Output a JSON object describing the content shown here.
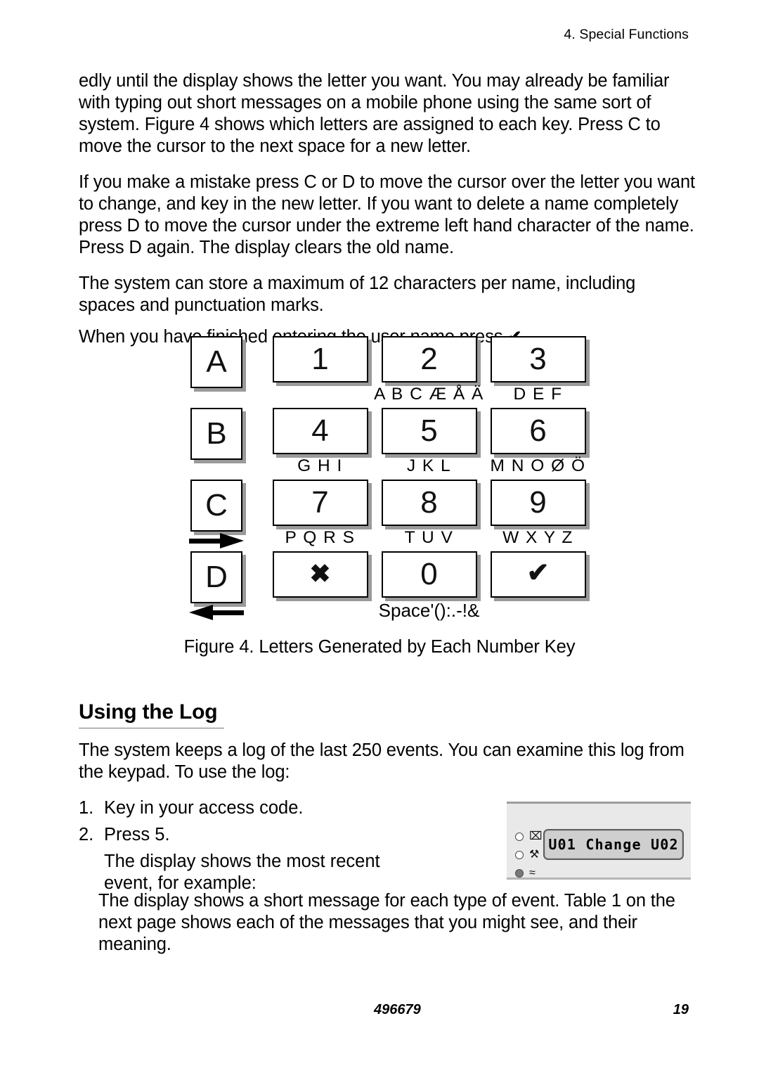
{
  "header": {
    "running_head": "4. Special Functions"
  },
  "paragraphs": {
    "p1": "edly until the display shows the letter you want. You may already be familiar with typing out short messages on a mobile phone using the same sort of system. Figure 4 shows which letters are assigned to each key. Press C to move the cursor to the next space for a new letter.",
    "p2": "If you make a mistake press C or D to move the cursor over the letter you want to change, and key in the new letter. If you want to delete a name completely press D to move the cursor under the extreme left hand character of the name. Press D again. The display clears the old name.",
    "p3": "The system can store a maximum of 12 characters per name, including spaces and punctuation marks.",
    "p4_before_tick": "When you have finished entering the user name press ",
    "p4_tick": "✔",
    "p4_after_tick": "."
  },
  "figure": {
    "caption": "Figure 4. Letters Generated by Each Number Key",
    "rows": [
      {
        "letter_key": "A",
        "letter_key_arrow": "",
        "keys": [
          {
            "face": "1",
            "sub": ""
          },
          {
            "face": "2",
            "sub": "A B C Æ Å Ä"
          },
          {
            "face": "3",
            "sub": "D E F"
          }
        ]
      },
      {
        "letter_key": "B",
        "letter_key_arrow": "",
        "keys": [
          {
            "face": "4",
            "sub": "G H I"
          },
          {
            "face": "5",
            "sub": "J K L"
          },
          {
            "face": "6",
            "sub": "M N O Ø Ö"
          }
        ]
      },
      {
        "letter_key": "C",
        "letter_key_arrow": "arrow-right-icon",
        "keys": [
          {
            "face": "7",
            "sub": "P Q R S"
          },
          {
            "face": "8",
            "sub": "T U V"
          },
          {
            "face": "9",
            "sub": "W X Y Z"
          }
        ]
      },
      {
        "letter_key": "D",
        "letter_key_arrow": "arrow-left-icon",
        "keys": [
          {
            "face": "✖",
            "sub": ""
          },
          {
            "face": "0",
            "sub": "Space'():.-!&"
          },
          {
            "face": "✔",
            "sub": ""
          }
        ]
      }
    ]
  },
  "section": {
    "heading": "Using the Log",
    "intro": "The system keeps a log of the last 250 events. You can examine this log from the keypad. To use the log:",
    "steps": [
      {
        "num": "1.",
        "text": "Key in your access code."
      },
      {
        "num": "2.",
        "text": "Press 5."
      }
    ],
    "step_note": "The display shows the most recent event, for example:",
    "closing": "The display shows a short message for each type of event. Table 1 on the next page shows each of the messages that you might see, and their meaning."
  },
  "display_graphic": {
    "lcd_text": "U01 Change U02",
    "leds": [
      {
        "state": "off",
        "icon": "crossed-bell-icon",
        "glyph": "⌧"
      },
      {
        "state": "off",
        "icon": "wrench-icon",
        "glyph": "⚒"
      },
      {
        "state": "on",
        "icon": "ac-power-icon",
        "glyph": "≈"
      }
    ]
  },
  "footer": {
    "doc_number": "496679",
    "page_number": "19"
  }
}
